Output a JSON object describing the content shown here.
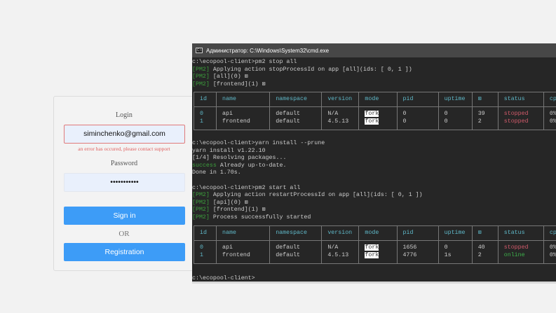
{
  "login_form": {
    "login_label": "Login",
    "login_value": "siminchenko@gmail.com",
    "error_message": "an error has occured, please contact support",
    "password_label": "Password",
    "password_value": "•••••••••••",
    "sign_in": "Sign in",
    "or": "OR",
    "registration": "Registration"
  },
  "terminal": {
    "title": "Администратор: C:\\Windows\\System32\\cmd.exe",
    "block1": [
      [
        [
          "",
          "c:\\ecopool-client>pm2 stop all"
        ]
      ],
      [
        [
          "g",
          "[PM2]"
        ],
        [
          "",
          " Applying action stopProcessId on app [all](ids: [ 0, 1 ])"
        ]
      ],
      [
        [
          "g",
          "[PM2]"
        ],
        [
          "",
          " [all](0) ⊠"
        ]
      ],
      [
        [
          "g",
          "[PM2]"
        ],
        [
          "",
          " [frontend](1) ⊠"
        ]
      ]
    ],
    "block2": [
      [
        [
          "",
          "c:\\ecopool-client>yarn install --prune"
        ]
      ],
      [
        [
          "",
          "yarn install v1.22.10"
        ]
      ],
      [
        [
          "",
          "[1/4] Resolving packages..."
        ]
      ],
      [
        [
          "g",
          "success"
        ],
        [
          "",
          " Already up-to-date."
        ]
      ],
      [
        [
          "",
          "Done in 1.70s."
        ]
      ],
      [
        [
          "",
          ""
        ]
      ],
      [
        [
          "",
          "c:\\ecopool-client>pm2 start all"
        ]
      ],
      [
        [
          "g",
          "[PM2]"
        ],
        [
          "",
          " Applying action restartProcessId on app [all](ids: [ 0, 1 ])"
        ]
      ],
      [
        [
          "g",
          "[PM2]"
        ],
        [
          "",
          " [api](0) ⊠"
        ]
      ],
      [
        [
          "g",
          "[PM2]"
        ],
        [
          "",
          " [frontend](1) ⊠"
        ]
      ],
      [
        [
          "g",
          "[PM2]"
        ],
        [
          "",
          " Process successfully started"
        ]
      ]
    ],
    "prompt": "c:\\ecopool-client>",
    "columns": [
      "id",
      "name",
      "namespace",
      "version",
      "mode",
      "pid",
      "uptime",
      "⊠",
      "status",
      "cpu"
    ],
    "table1": [
      {
        "id": "0",
        "name": "api",
        "namespace": "default",
        "version": "N/A",
        "mode": "fork",
        "pid": "0",
        "uptime": "0",
        "restarts": "39",
        "status": "stopped",
        "cpu": "0%"
      },
      {
        "id": "1",
        "name": "frontend",
        "namespace": "default",
        "version": "4.5.13",
        "mode": "fork",
        "pid": "0",
        "uptime": "0",
        "restarts": "2",
        "status": "stopped",
        "cpu": "0%"
      }
    ],
    "table2": [
      {
        "id": "0",
        "name": "api",
        "namespace": "default",
        "version": "N/A",
        "mode": "fork",
        "pid": "1656",
        "uptime": "0",
        "restarts": "40",
        "status": "stopped",
        "cpu": "0%"
      },
      {
        "id": "1",
        "name": "frontend",
        "namespace": "default",
        "version": "4.5.13",
        "mode": "fork",
        "pid": "4776",
        "uptime": "1s",
        "restarts": "2",
        "status": "online",
        "cpu": "0%"
      }
    ]
  }
}
